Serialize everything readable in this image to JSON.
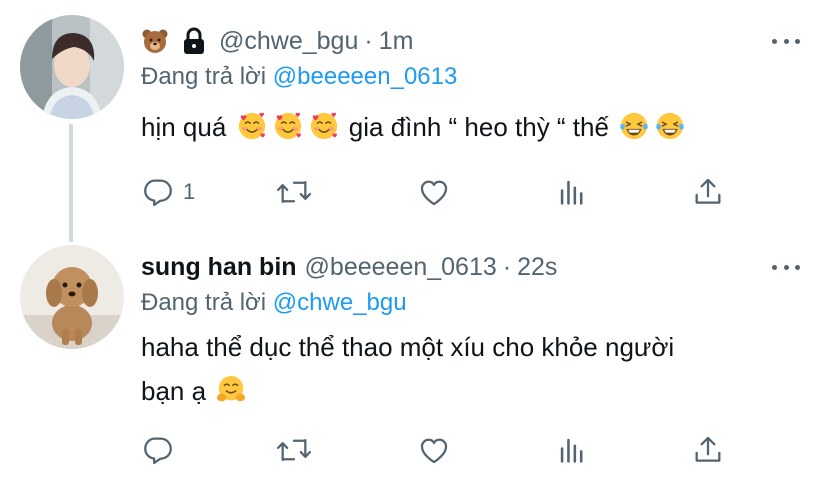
{
  "tweets": [
    {
      "display_name": "",
      "badges": [
        "bear-emoji",
        "lock-icon"
      ],
      "handle": "@chwe_bgu",
      "separator": "·",
      "time": "1m",
      "replying_label": "Đang trả lời",
      "replying_to": "@beeeeen_0613",
      "text_segments": [
        "hịn quá",
        "gia đình “ heo thỳ “ thế"
      ],
      "emojis": [
        "smiling-face-with-hearts",
        "face-with-tears-of-joy"
      ],
      "reply_count": "1",
      "retweet_count": "",
      "like_count": "",
      "view_count": ""
    },
    {
      "display_name": "sung han bin",
      "handle": "@beeeeen_0613",
      "separator": "·",
      "time": "22s",
      "replying_label": "Đang trả lời",
      "replying_to": "@chwe_bgu",
      "text_line1": "haha thể dục thể thao một xíu cho khỏe người",
      "text_line2": "bạn ạ",
      "emojis": [
        "hugging-face"
      ],
      "reply_count": "",
      "retweet_count": "",
      "like_count": "",
      "view_count": ""
    }
  ],
  "colors": {
    "text": "#0f1419",
    "secondary": "#536471",
    "link": "#1d9bf0",
    "thread_line": "#cfd9de"
  }
}
